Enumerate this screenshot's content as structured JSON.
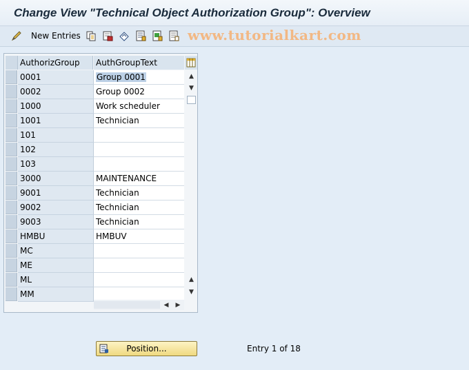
{
  "window": {
    "title": "Change View \"Technical Object Authorization Group\": Overview"
  },
  "toolbar": {
    "new_entries_label": "New Entries",
    "watermark": "www.tutorialkart.com"
  },
  "table": {
    "columns": [
      "AuthorizGroup",
      "AuthGroupText"
    ],
    "rows": [
      [
        "0001",
        "Group 0001"
      ],
      [
        "0002",
        "Group 0002"
      ],
      [
        "1000",
        "Work scheduler"
      ],
      [
        "1001",
        "Technician"
      ],
      [
        "101",
        ""
      ],
      [
        "102",
        ""
      ],
      [
        "103",
        ""
      ],
      [
        "3000",
        "MAINTENANCE"
      ],
      [
        "9001",
        "Technician"
      ],
      [
        "9002",
        "Technician"
      ],
      [
        "9003",
        "Technician"
      ],
      [
        "HMBU",
        "HMBUV"
      ],
      [
        "MC",
        ""
      ],
      [
        "ME",
        ""
      ],
      [
        "ML",
        ""
      ],
      [
        "MM",
        ""
      ]
    ]
  },
  "footer": {
    "position_label": "Position...",
    "entry_info": "Entry 1 of 18"
  }
}
